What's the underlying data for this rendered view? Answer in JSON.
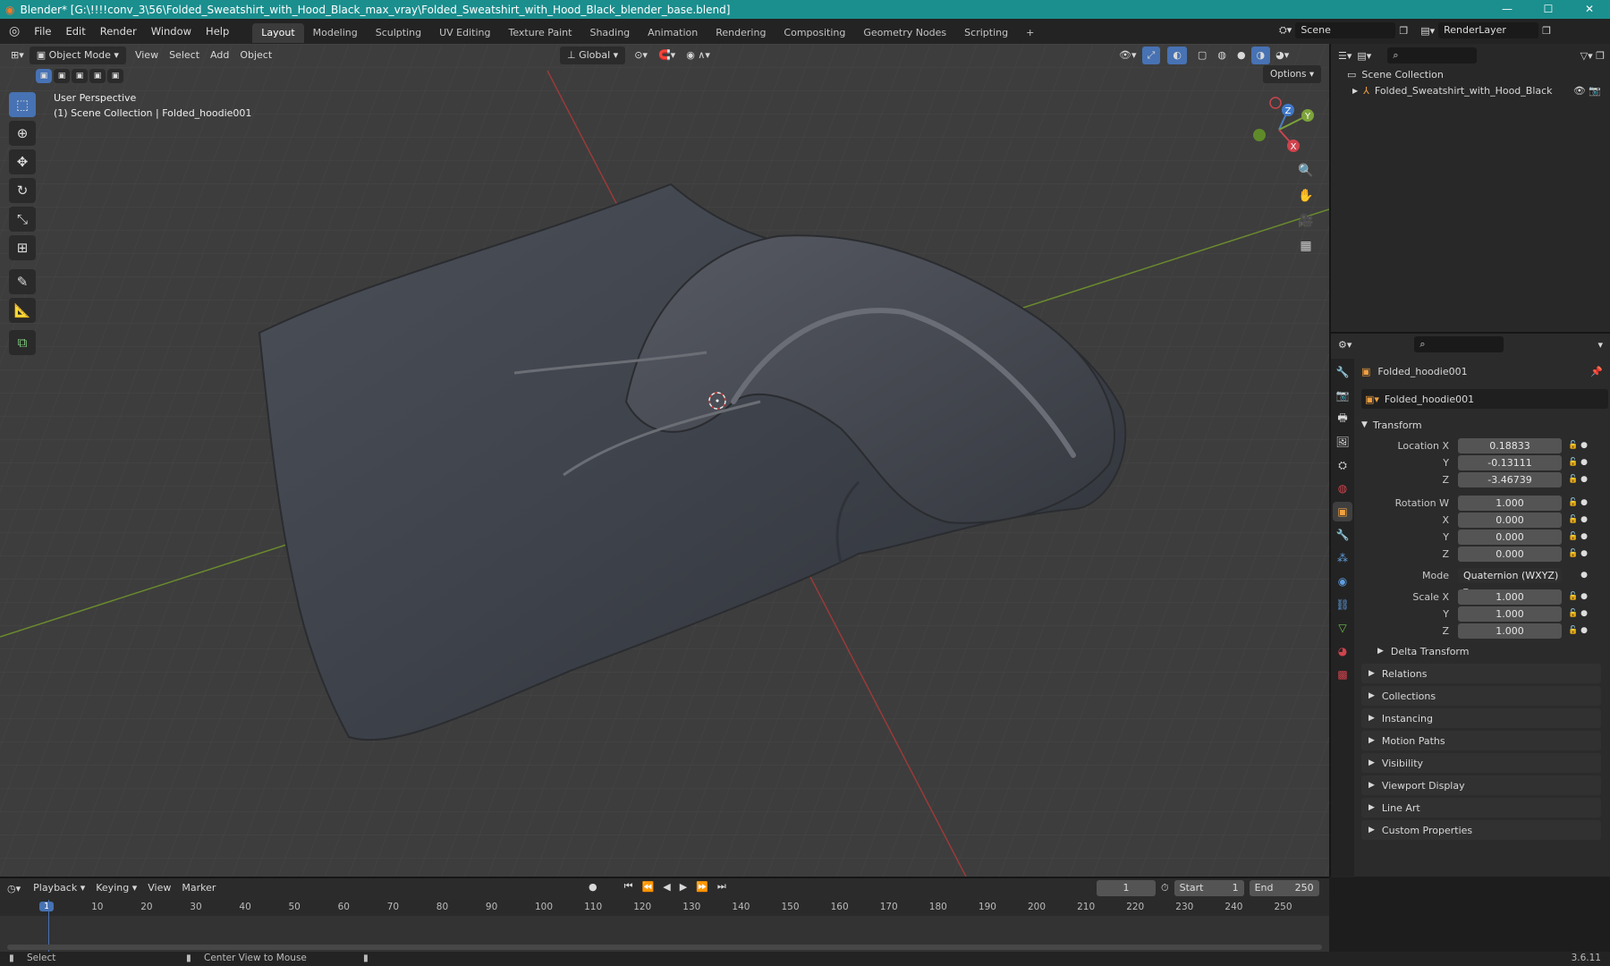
{
  "window": {
    "title": "Blender* [G:\\!!!!conv_3\\56\\Folded_Sweatshirt_with_Hood_Black_max_vray\\Folded_Sweatshirt_with_Hood_Black_blender_base.blend]",
    "minimize": "—",
    "maximize": "☐",
    "close": "✕"
  },
  "menu": [
    "File",
    "Edit",
    "Render",
    "Window",
    "Help"
  ],
  "workspaces": [
    "Layout",
    "Modeling",
    "Sculpting",
    "UV Editing",
    "Texture Paint",
    "Shading",
    "Animation",
    "Rendering",
    "Compositing",
    "Geometry Nodes",
    "Scripting",
    "+"
  ],
  "scene": {
    "label": "Scene",
    "view_layer": "RenderLayer"
  },
  "viewport": {
    "mode": "Object Mode",
    "menus": [
      "View",
      "Select",
      "Add",
      "Object"
    ],
    "orientation": "Global",
    "options": "Options",
    "perspective": "User Perspective",
    "collection_info": "(1) Scene Collection | Folded_hoodie001",
    "gizmo": {
      "z": "Z",
      "y": "Y",
      "x": "X"
    }
  },
  "outliner": {
    "root": "Scene Collection",
    "items": [
      {
        "name": "Folded_Sweatshirt_with_Hood_Black"
      }
    ]
  },
  "properties": {
    "object_name": "Folded_hoodie001",
    "data_name": "Folded_hoodie001",
    "transform_title": "Transform",
    "location": {
      "label": "Location X",
      "x": "0.18833",
      "y": "-0.13111",
      "z": "-3.46739"
    },
    "rotation": {
      "label": "Rotation W",
      "w": "1.000",
      "x": "0.000",
      "y": "0.000",
      "z": "0.000"
    },
    "mode": {
      "label": "Mode",
      "value": "Quaternion (WXYZ)"
    },
    "scale": {
      "label": "Scale X",
      "x": "1.000",
      "y": "1.000",
      "z": "1.000"
    },
    "axis_labels": {
      "x": "X",
      "y": "Y",
      "z": "Z"
    },
    "delta": "Delta Transform",
    "panels": [
      "Relations",
      "Collections",
      "Instancing",
      "Motion Paths",
      "Visibility",
      "Viewport Display",
      "Line Art",
      "Custom Properties"
    ]
  },
  "timeline": {
    "menus": [
      "Playback",
      "Keying",
      "View",
      "Marker"
    ],
    "current_frame": "1",
    "start_label": "Start",
    "start": "1",
    "end_label": "End",
    "end": "250",
    "ruler": [
      "10",
      "20",
      "30",
      "40",
      "50",
      "60",
      "70",
      "80",
      "90",
      "100",
      "110",
      "120",
      "130",
      "140",
      "150",
      "160",
      "170",
      "180",
      "190",
      "200",
      "210",
      "220",
      "230",
      "240",
      "250"
    ],
    "playhead": "1"
  },
  "status": {
    "select": "Select",
    "center": "Center View to Mouse",
    "version": "3.6.11"
  }
}
